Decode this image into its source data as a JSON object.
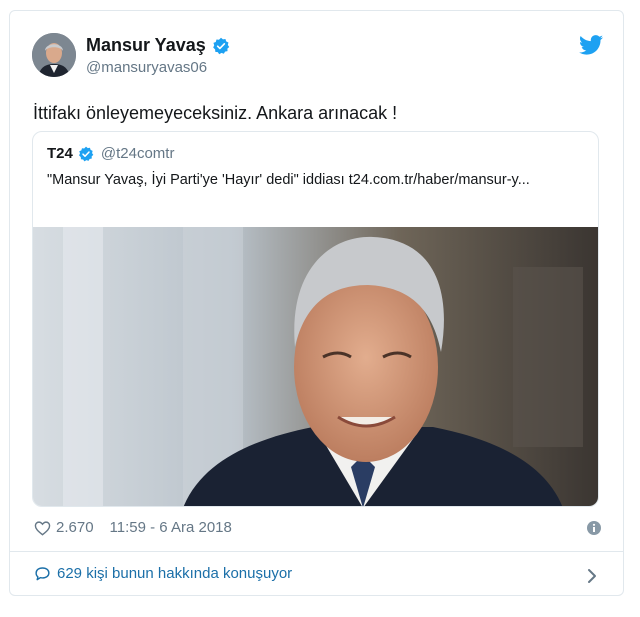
{
  "author": {
    "name": "Mansur Yavaş",
    "handle": "@mansuryavas06",
    "verified": true
  },
  "tweet": {
    "text": "İttifakı önleyemeyeceksiniz. Ankara arınacak !"
  },
  "quoted": {
    "name": "T24",
    "handle": "@t24comtr",
    "verified": true,
    "text": "\"Mansur Yavaş, İyi Parti'ye 'Hayır' dedi\" iddiası t24.com.tr/haber/mansur-y..."
  },
  "meta": {
    "likes": "2.670",
    "timestamp": "11:59 - 6 Ara 2018"
  },
  "conversation": {
    "label": "629 kişi bunun hakkında konuşuyor"
  },
  "colors": {
    "accent": "#1da1f2",
    "link": "#1b6fa8",
    "muted": "#657786",
    "border": "#e1e8ed"
  },
  "icons": [
    "verified-badge-icon",
    "twitter-bird-icon",
    "heart-icon",
    "info-icon",
    "speech-bubble-icon",
    "chevron-right-icon"
  ]
}
